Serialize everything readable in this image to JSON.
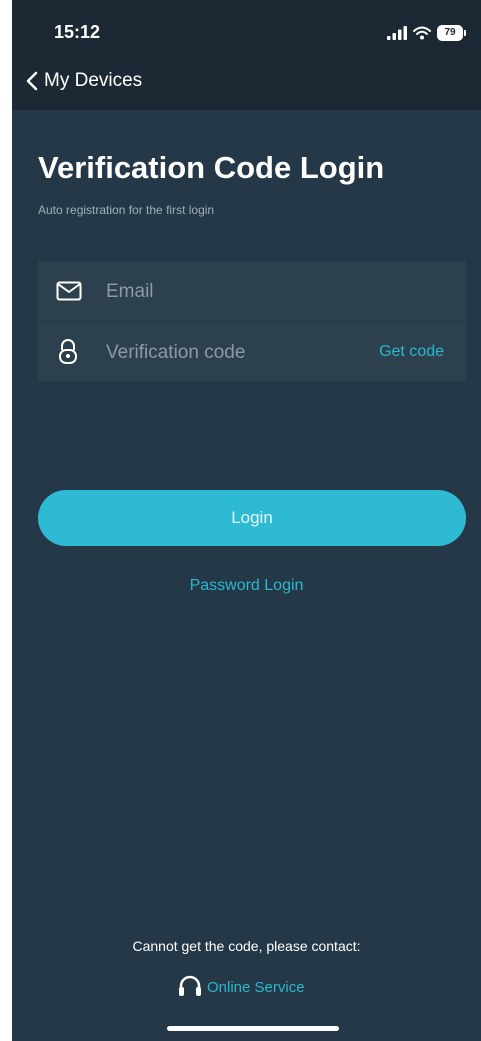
{
  "status": {
    "time": "15:12",
    "battery": "79"
  },
  "nav": {
    "back_label": "My Devices"
  },
  "header": {
    "title": "Verification Code Login",
    "subtitle": "Auto registration for the first login"
  },
  "form": {
    "email_placeholder": "Email",
    "code_placeholder": "Verification code",
    "get_code_label": "Get code"
  },
  "actions": {
    "login_label": "Login",
    "password_login_label": "Password Login"
  },
  "footer": {
    "contact_text": "Cannot get the code, please contact:",
    "online_service_label": "Online Service"
  },
  "icons": {
    "back": "chevron-left-icon",
    "email": "envelope-icon",
    "code": "lock-icon",
    "service": "headset-icon"
  },
  "colors": {
    "background": "#243847",
    "topbar": "#1c2935",
    "accent": "#2ebad2",
    "field_bg": "#2d404e"
  }
}
